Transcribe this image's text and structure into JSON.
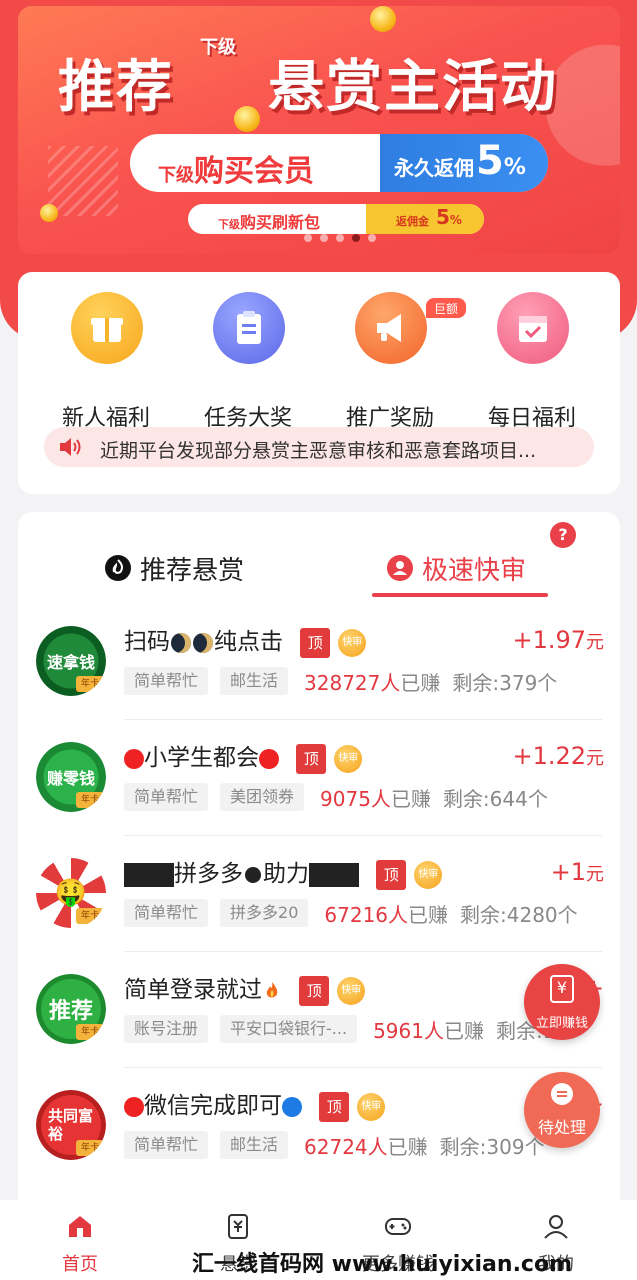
{
  "banner": {
    "title_left": "推荐",
    "title_small": "下级",
    "title_right": "悬赏主活动",
    "pill1_small": "下级",
    "pill1_main": "购买会员",
    "pill1_right_text": "永久返佣",
    "pill1_right_value": "5",
    "pill1_right_unit": "%",
    "pill2_small": "下级",
    "pill2_main": "购买刷新包",
    "pill2_right_text": "返佣金",
    "pill2_right_value": "5",
    "pill2_right_unit": "%",
    "slide_count": 5,
    "active_slide": 4
  },
  "menu": {
    "items": [
      {
        "label": "新人福利",
        "icon": "gift-box-icon",
        "color": "#f7b52c"
      },
      {
        "label": "任务大奖",
        "icon": "clipboard-icon",
        "color": "#6f7df0"
      },
      {
        "label": "推广奖励",
        "icon": "megaphone-icon",
        "color": "#f7733a"
      },
      {
        "label": "每日福利",
        "icon": "calendar-check-icon",
        "color": "#f46a8a"
      }
    ],
    "badge": "巨额",
    "notice": "近期平台发现部分悬赏主恶意审核和恶意套路项目..."
  },
  "tabs": {
    "recommend": "推荐悬赏",
    "fast": "极速快审",
    "help": "?"
  },
  "tasks": [
    {
      "title": "扫码",
      "title_suffix": "纯点击",
      "avatar_text": "速拿钱",
      "avatar_badge": "年卡",
      "tag_top": "顶",
      "tag_fast": "快审",
      "reward": "+1.97",
      "reward_unit": "元",
      "chips": [
        "简单帮忙",
        "邮生活"
      ],
      "earned": "328727人",
      "earned_label": "已赚",
      "remain": "剩余:379个"
    },
    {
      "title": "小学生都会",
      "avatar_text": "赚零钱",
      "avatar_badge": "年卡",
      "tag_top": "顶",
      "tag_fast": "快审",
      "reward": "+1.22",
      "reward_unit": "元",
      "chips": [
        "简单帮忙",
        "美团领券"
      ],
      "earned": "9075人",
      "earned_label": "已赚",
      "remain": "剩余:644个"
    },
    {
      "title": "拼多多",
      "title_mid": "助力",
      "avatar_text": "🤑",
      "avatar_badge": "年卡",
      "tag_top": "顶",
      "tag_fast": "快审",
      "reward": "+1",
      "reward_unit": "元",
      "chips": [
        "简单帮忙",
        "拼多多20"
      ],
      "earned": "67216人",
      "earned_label": "已赚",
      "remain": "剩余:4280个"
    },
    {
      "title": "简单登录就过",
      "avatar_text": "推荐",
      "avatar_badge": "年卡",
      "tag_top": "顶",
      "tag_fast": "快审",
      "reward": "+",
      "reward_unit": "",
      "chips": [
        "账号注册",
        "平安口袋银行-..."
      ],
      "earned": "5961人",
      "earned_label": "已赚",
      "remain": "剩余:1个"
    },
    {
      "title": "微信完成即可",
      "avatar_text": "共同富裕",
      "avatar_badge": "年卡",
      "tag_top": "顶",
      "tag_fast": "快审",
      "reward": "+",
      "reward_unit": "",
      "chips": [
        "简单帮忙",
        "邮生活"
      ],
      "earned": "62724人",
      "earned_label": "已赚",
      "remain": "剩余:309个"
    }
  ],
  "floats": {
    "earn_now": "立即赚钱",
    "earn_symbol": "¥",
    "pending": "待处理"
  },
  "bottom_nav": {
    "home": "首页",
    "reward": "悬赏",
    "more": "更多赚钱",
    "me": "我的",
    "watermark": "汇一线首码网 www.huiyixian.com"
  },
  "colors": {
    "brand_red": "#f24a48",
    "accent_red": "#e2383f"
  }
}
